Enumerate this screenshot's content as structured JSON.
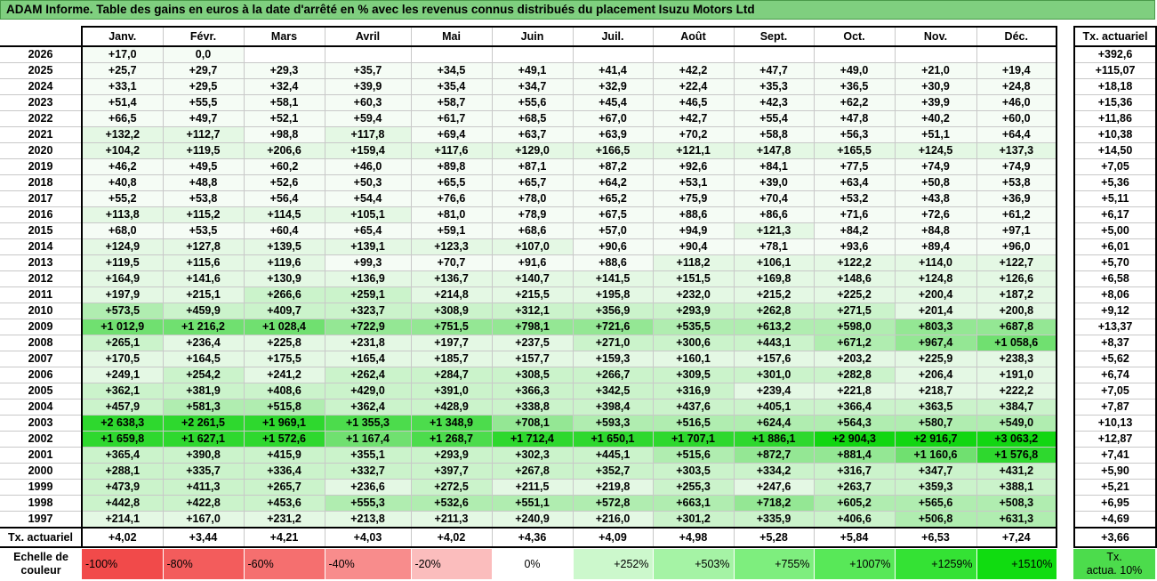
{
  "title": "ADAM Informe. Table des gains en euros à la date d'arrêté en % avec les revenus connus distribués du placement Isuzu Motors Ltd",
  "months": [
    "Janv.",
    "Févr.",
    "Mars",
    "Avril",
    "Mai",
    "Juin",
    "Juil.",
    "Août",
    "Sept.",
    "Oct.",
    "Nov.",
    "Déc."
  ],
  "side_header": "Tx. actuariel",
  "footer_label": "Tx. actuariel",
  "footer_values": [
    "+4,02",
    "+3,44",
    "+4,21",
    "+4,03",
    "+4,02",
    "+4,36",
    "+4,09",
    "+4,98",
    "+5,28",
    "+5,84",
    "+6,53",
    "+7,24"
  ],
  "footer_side": "+3,66",
  "rows": [
    {
      "year": "2026",
      "values": [
        "+17,0",
        "0,0",
        "",
        "",
        "",
        "",
        "",
        "",
        "",
        "",
        "",
        ""
      ],
      "levels": [
        0,
        0,
        -1,
        -1,
        -1,
        -1,
        -1,
        -1,
        -1,
        -1,
        -1,
        -1
      ],
      "tx": "+392,6"
    },
    {
      "year": "2025",
      "values": [
        "+25,7",
        "+29,7",
        "+29,3",
        "+35,7",
        "+34,5",
        "+49,1",
        "+41,4",
        "+42,2",
        "+47,7",
        "+49,0",
        "+21,0",
        "+19,4"
      ],
      "levels": [
        0,
        0,
        0,
        0,
        0,
        0,
        0,
        0,
        0,
        0,
        0,
        0
      ],
      "tx": "+115,07"
    },
    {
      "year": "2024",
      "values": [
        "+33,1",
        "+29,5",
        "+32,4",
        "+39,9",
        "+35,4",
        "+34,7",
        "+32,9",
        "+22,4",
        "+35,3",
        "+36,5",
        "+30,9",
        "+24,8"
      ],
      "levels": [
        0,
        0,
        0,
        0,
        0,
        0,
        0,
        0,
        0,
        0,
        0,
        0
      ],
      "tx": "+18,18"
    },
    {
      "year": "2023",
      "values": [
        "+51,4",
        "+55,5",
        "+58,1",
        "+60,3",
        "+58,7",
        "+55,6",
        "+45,4",
        "+46,5",
        "+42,3",
        "+62,2",
        "+39,9",
        "+46,0"
      ],
      "levels": [
        0,
        0,
        0,
        0,
        0,
        0,
        0,
        0,
        0,
        0,
        0,
        0
      ],
      "tx": "+15,36"
    },
    {
      "year": "2022",
      "values": [
        "+66,5",
        "+49,7",
        "+52,1",
        "+59,4",
        "+61,7",
        "+68,5",
        "+67,0",
        "+42,7",
        "+55,4",
        "+47,8",
        "+40,2",
        "+60,0"
      ],
      "levels": [
        0,
        0,
        0,
        0,
        0,
        0,
        0,
        0,
        0,
        0,
        0,
        0
      ],
      "tx": "+11,86"
    },
    {
      "year": "2021",
      "values": [
        "+132,2",
        "+112,7",
        "+98,8",
        "+117,8",
        "+69,4",
        "+63,7",
        "+63,9",
        "+70,2",
        "+58,8",
        "+56,3",
        "+51,1",
        "+64,4"
      ],
      "levels": [
        1,
        1,
        0,
        1,
        0,
        0,
        0,
        0,
        0,
        0,
        0,
        0
      ],
      "tx": "+10,38"
    },
    {
      "year": "2020",
      "values": [
        "+104,2",
        "+119,5",
        "+206,6",
        "+159,4",
        "+117,6",
        "+129,0",
        "+166,5",
        "+121,1",
        "+147,8",
        "+165,5",
        "+124,5",
        "+137,3"
      ],
      "levels": [
        1,
        1,
        1,
        1,
        1,
        1,
        1,
        1,
        1,
        1,
        1,
        1
      ],
      "tx": "+14,50"
    },
    {
      "year": "2019",
      "values": [
        "+46,2",
        "+49,5",
        "+60,2",
        "+46,0",
        "+89,8",
        "+87,1",
        "+87,2",
        "+92,6",
        "+84,1",
        "+77,5",
        "+74,9",
        "+74,9"
      ],
      "levels": [
        0,
        0,
        0,
        0,
        0,
        0,
        0,
        0,
        0,
        0,
        0,
        0
      ],
      "tx": "+7,05"
    },
    {
      "year": "2018",
      "values": [
        "+40,8",
        "+48,8",
        "+52,6",
        "+50,3",
        "+65,5",
        "+65,7",
        "+64,2",
        "+53,1",
        "+39,0",
        "+63,4",
        "+50,8",
        "+53,8"
      ],
      "levels": [
        0,
        0,
        0,
        0,
        0,
        0,
        0,
        0,
        0,
        0,
        0,
        0
      ],
      "tx": "+5,36"
    },
    {
      "year": "2017",
      "values": [
        "+55,2",
        "+53,8",
        "+56,4",
        "+54,4",
        "+76,6",
        "+78,0",
        "+65,2",
        "+75,9",
        "+70,4",
        "+53,2",
        "+43,8",
        "+36,9"
      ],
      "levels": [
        0,
        0,
        0,
        0,
        0,
        0,
        0,
        0,
        0,
        0,
        0,
        0
      ],
      "tx": "+5,11"
    },
    {
      "year": "2016",
      "values": [
        "+113,8",
        "+115,2",
        "+114,5",
        "+105,1",
        "+81,0",
        "+78,9",
        "+67,5",
        "+88,6",
        "+86,6",
        "+71,6",
        "+72,6",
        "+61,2"
      ],
      "levels": [
        1,
        1,
        1,
        1,
        0,
        0,
        0,
        0,
        0,
        0,
        0,
        0
      ],
      "tx": "+6,17"
    },
    {
      "year": "2015",
      "values": [
        "+68,0",
        "+53,5",
        "+60,4",
        "+65,4",
        "+59,1",
        "+68,6",
        "+57,0",
        "+94,9",
        "+121,3",
        "+84,2",
        "+84,8",
        "+97,1"
      ],
      "levels": [
        0,
        0,
        0,
        0,
        0,
        0,
        0,
        0,
        1,
        0,
        0,
        0
      ],
      "tx": "+5,00"
    },
    {
      "year": "2014",
      "values": [
        "+124,9",
        "+127,8",
        "+139,5",
        "+139,1",
        "+123,3",
        "+107,0",
        "+90,6",
        "+90,4",
        "+78,1",
        "+93,6",
        "+89,4",
        "+96,0"
      ],
      "levels": [
        1,
        1,
        1,
        1,
        1,
        1,
        0,
        0,
        0,
        0,
        0,
        0
      ],
      "tx": "+6,01"
    },
    {
      "year": "2013",
      "values": [
        "+119,5",
        "+115,6",
        "+119,6",
        "+99,3",
        "+70,7",
        "+91,6",
        "+88,6",
        "+118,2",
        "+106,1",
        "+122,2",
        "+114,0",
        "+122,7"
      ],
      "levels": [
        1,
        1,
        1,
        0,
        0,
        0,
        0,
        1,
        1,
        1,
        1,
        1
      ],
      "tx": "+5,70"
    },
    {
      "year": "2012",
      "values": [
        "+164,9",
        "+141,6",
        "+130,9",
        "+136,9",
        "+136,7",
        "+140,7",
        "+141,5",
        "+151,5",
        "+169,8",
        "+148,6",
        "+124,8",
        "+126,6"
      ],
      "levels": [
        1,
        1,
        1,
        1,
        1,
        1,
        1,
        1,
        1,
        1,
        1,
        1
      ],
      "tx": "+6,58"
    },
    {
      "year": "2011",
      "values": [
        "+197,9",
        "+215,1",
        "+266,6",
        "+259,1",
        "+214,8",
        "+215,5",
        "+195,8",
        "+232,0",
        "+215,2",
        "+225,2",
        "+200,4",
        "+187,2"
      ],
      "levels": [
        1,
        1,
        2,
        2,
        1,
        1,
        1,
        1,
        1,
        1,
        1,
        1
      ],
      "tx": "+8,06"
    },
    {
      "year": "2010",
      "values": [
        "+573,5",
        "+459,9",
        "+409,7",
        "+323,7",
        "+308,9",
        "+312,1",
        "+356,9",
        "+293,9",
        "+262,8",
        "+271,5",
        "+201,4",
        "+200,8"
      ],
      "levels": [
        3,
        2,
        2,
        2,
        2,
        2,
        2,
        2,
        2,
        2,
        1,
        1
      ],
      "tx": "+9,12"
    },
    {
      "year": "2009",
      "values": [
        "+1 012,9",
        "+1 216,2",
        "+1 028,4",
        "+722,9",
        "+751,5",
        "+798,1",
        "+721,6",
        "+535,5",
        "+613,2",
        "+598,0",
        "+803,3",
        "+687,8"
      ],
      "levels": [
        5,
        5,
        5,
        4,
        4,
        4,
        4,
        3,
        3,
        3,
        4,
        4
      ],
      "tx": "+13,37"
    },
    {
      "year": "2008",
      "values": [
        "+265,1",
        "+236,4",
        "+225,8",
        "+231,8",
        "+197,7",
        "+237,5",
        "+271,0",
        "+300,6",
        "+443,1",
        "+671,2",
        "+967,4",
        "+1 058,6"
      ],
      "levels": [
        2,
        1,
        1,
        1,
        1,
        1,
        2,
        2,
        2,
        3,
        4,
        5
      ],
      "tx": "+8,37"
    },
    {
      "year": "2007",
      "values": [
        "+170,5",
        "+164,5",
        "+175,5",
        "+165,4",
        "+185,7",
        "+157,7",
        "+159,3",
        "+160,1",
        "+157,6",
        "+203,2",
        "+225,9",
        "+238,3"
      ],
      "levels": [
        1,
        1,
        1,
        1,
        1,
        1,
        1,
        1,
        1,
        1,
        1,
        1
      ],
      "tx": "+5,62"
    },
    {
      "year": "2006",
      "values": [
        "+249,1",
        "+254,2",
        "+241,2",
        "+262,4",
        "+284,7",
        "+308,5",
        "+266,7",
        "+309,5",
        "+301,0",
        "+282,8",
        "+206,4",
        "+191,0"
      ],
      "levels": [
        1,
        2,
        1,
        2,
        2,
        2,
        2,
        2,
        2,
        2,
        1,
        1
      ],
      "tx": "+6,74"
    },
    {
      "year": "2005",
      "values": [
        "+362,1",
        "+381,9",
        "+408,6",
        "+429,0",
        "+391,0",
        "+366,3",
        "+342,5",
        "+316,9",
        "+239,4",
        "+221,8",
        "+218,7",
        "+222,2"
      ],
      "levels": [
        2,
        2,
        2,
        2,
        2,
        2,
        2,
        2,
        1,
        1,
        1,
        1
      ],
      "tx": "+7,05"
    },
    {
      "year": "2004",
      "values": [
        "+457,9",
        "+581,3",
        "+515,8",
        "+362,4",
        "+428,9",
        "+338,8",
        "+398,4",
        "+437,6",
        "+405,1",
        "+366,4",
        "+363,5",
        "+384,7"
      ],
      "levels": [
        2,
        3,
        3,
        2,
        2,
        2,
        2,
        2,
        2,
        2,
        2,
        2
      ],
      "tx": "+7,87"
    },
    {
      "year": "2003",
      "values": [
        "+2 638,3",
        "+2 261,5",
        "+1 969,1",
        "+1 355,3",
        "+1 348,9",
        "+708,1",
        "+593,3",
        "+516,5",
        "+624,4",
        "+564,3",
        "+580,7",
        "+549,0"
      ],
      "levels": [
        7,
        7,
        7,
        6,
        6,
        4,
        3,
        3,
        3,
        3,
        3,
        3
      ],
      "tx": "+10,13"
    },
    {
      "year": "2002",
      "values": [
        "+1 659,8",
        "+1 627,1",
        "+1 572,6",
        "+1 167,4",
        "+1 268,7",
        "+1 712,4",
        "+1 650,1",
        "+1 707,1",
        "+1 886,1",
        "+2 904,3",
        "+2 916,7",
        "+3 063,2"
      ],
      "levels": [
        7,
        7,
        7,
        5,
        6,
        7,
        7,
        7,
        7,
        8,
        8,
        8
      ],
      "tx": "+12,87"
    },
    {
      "year": "2001",
      "values": [
        "+365,4",
        "+390,8",
        "+415,9",
        "+355,1",
        "+293,9",
        "+302,3",
        "+445,1",
        "+515,6",
        "+872,7",
        "+881,4",
        "+1 160,6",
        "+1 576,8"
      ],
      "levels": [
        2,
        2,
        2,
        2,
        2,
        2,
        2,
        3,
        4,
        4,
        5,
        7
      ],
      "tx": "+7,41"
    },
    {
      "year": "2000",
      "values": [
        "+288,1",
        "+335,7",
        "+336,4",
        "+332,7",
        "+397,7",
        "+267,8",
        "+352,7",
        "+303,5",
        "+334,2",
        "+316,7",
        "+347,7",
        "+431,2"
      ],
      "levels": [
        2,
        2,
        2,
        2,
        2,
        2,
        2,
        2,
        2,
        2,
        2,
        2
      ],
      "tx": "+5,90"
    },
    {
      "year": "1999",
      "values": [
        "+473,9",
        "+411,3",
        "+265,7",
        "+236,6",
        "+272,5",
        "+211,5",
        "+219,8",
        "+255,3",
        "+247,6",
        "+263,7",
        "+359,3",
        "+388,1"
      ],
      "levels": [
        2,
        2,
        2,
        1,
        2,
        1,
        1,
        2,
        1,
        2,
        2,
        2
      ],
      "tx": "+5,21"
    },
    {
      "year": "1998",
      "values": [
        "+442,8",
        "+422,8",
        "+453,6",
        "+555,3",
        "+532,6",
        "+551,1",
        "+572,8",
        "+663,1",
        "+718,2",
        "+605,2",
        "+565,6",
        "+508,3"
      ],
      "levels": [
        2,
        2,
        2,
        3,
        3,
        3,
        3,
        3,
        4,
        3,
        3,
        3
      ],
      "tx": "+6,95"
    },
    {
      "year": "1997",
      "values": [
        "+214,1",
        "+167,0",
        "+231,2",
        "+213,8",
        "+211,3",
        "+240,9",
        "+216,0",
        "+301,2",
        "+335,9",
        "+406,6",
        "+506,8",
        "+631,3"
      ],
      "levels": [
        1,
        1,
        1,
        1,
        1,
        1,
        1,
        2,
        2,
        2,
        3,
        3
      ],
      "tx": "+4,69"
    }
  ],
  "level_colors": [
    "#f5fcf5",
    "#e4f8e4",
    "#cbf3cb",
    "#b0edb0",
    "#94e794",
    "#70e070",
    "#4cdc4c",
    "#2ed82e",
    "#12d612"
  ],
  "scale": {
    "label_line1": "Echelle de",
    "label_line2": "couleur",
    "items": [
      {
        "text": "-100%",
        "color": "#f14a4a"
      },
      {
        "text": "-80%",
        "color": "#f35c5c"
      },
      {
        "text": "-60%",
        "color": "#f56f6f"
      },
      {
        "text": "-40%",
        "color": "#f88c8c"
      },
      {
        "text": "-20%",
        "color": "#fbbdbd"
      },
      {
        "text": "0%",
        "color": "#ffffff"
      },
      {
        "text": "+252%",
        "color": "#ccf8cc"
      },
      {
        "text": "+503%",
        "color": "#a5f3a5"
      },
      {
        "text": "+755%",
        "color": "#7eee7e"
      },
      {
        "text": "+1007%",
        "color": "#58e858"
      },
      {
        "text": "+1259%",
        "color": "#34e234"
      },
      {
        "text": "+1510%",
        "color": "#10dc10"
      }
    ],
    "tx_line1": "Tx.",
    "tx_line2": "actua. 10%",
    "tx_color": "#4cdc4c"
  }
}
